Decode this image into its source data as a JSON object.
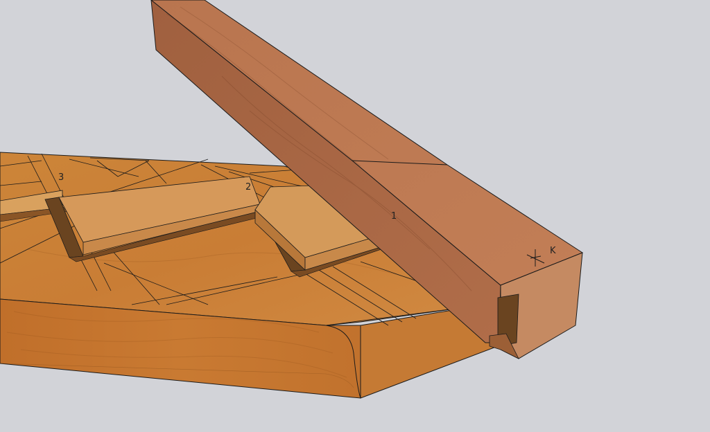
{
  "scene": {
    "background_color": "#d2d3d8",
    "colors": {
      "board_top": "#c9803a",
      "board_front": "#c4742c",
      "board_curve": "#b9692a",
      "tenon_face": "#d9a15e",
      "mortise_shadow": "#6a4420",
      "rafter_top": "#b56f4a",
      "rafter_side": "#a6623f",
      "rafter_end": "#c58a62",
      "edge_line": "#1a1a1a"
    },
    "pencil_marks": [
      "3",
      "2",
      "1"
    ],
    "end_mark": "K",
    "icons": [
      "board",
      "rafter",
      "tenon"
    ]
  }
}
